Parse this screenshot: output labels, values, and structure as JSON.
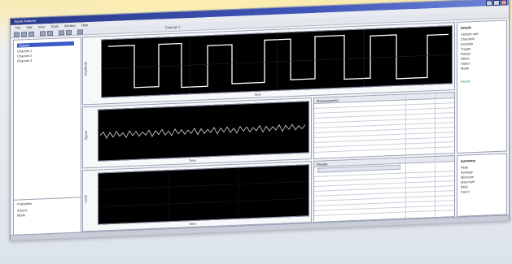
{
  "window": {
    "title": "Signal Analyzer"
  },
  "menu": [
    "File",
    "Edit",
    "View",
    "Tools",
    "Window",
    "Help"
  ],
  "toolbar": {
    "status_text": "Channel 1"
  },
  "left_panel": {
    "header": "Signals",
    "items": [
      "Channel 1",
      "Channel 2",
      "Channel 3"
    ],
    "bottom_title": "Properties",
    "bottom_items": [
      "Source",
      "Mode"
    ]
  },
  "plots": {
    "top": {
      "ylabel": "Amplitude",
      "xlabel": "Time"
    },
    "middle": {
      "ylabel": "Signal",
      "xlabel": "Time"
    },
    "bottom": {
      "ylabel": "Level",
      "xlabel": "Time"
    }
  },
  "tables": {
    "upper": {
      "title": "Measurements"
    },
    "lower": {
      "title": "Results"
    }
  },
  "right_panel": {
    "upper_title": "Details",
    "upper_lines": [
      "Sample rate",
      "Channels",
      "Duration",
      "Trigger",
      "Range",
      "Offset",
      "Status",
      "Mode"
    ],
    "upper_green": "Ready",
    "lower_title": "Summary",
    "lower_lines": [
      "Peak",
      "Average",
      "Minimum",
      "Maximum",
      "RMS",
      "Count"
    ]
  },
  "colors": {
    "accent": "#3b59c4",
    "trace": "#ffffff",
    "status_ok": "#2f8a3d"
  }
}
